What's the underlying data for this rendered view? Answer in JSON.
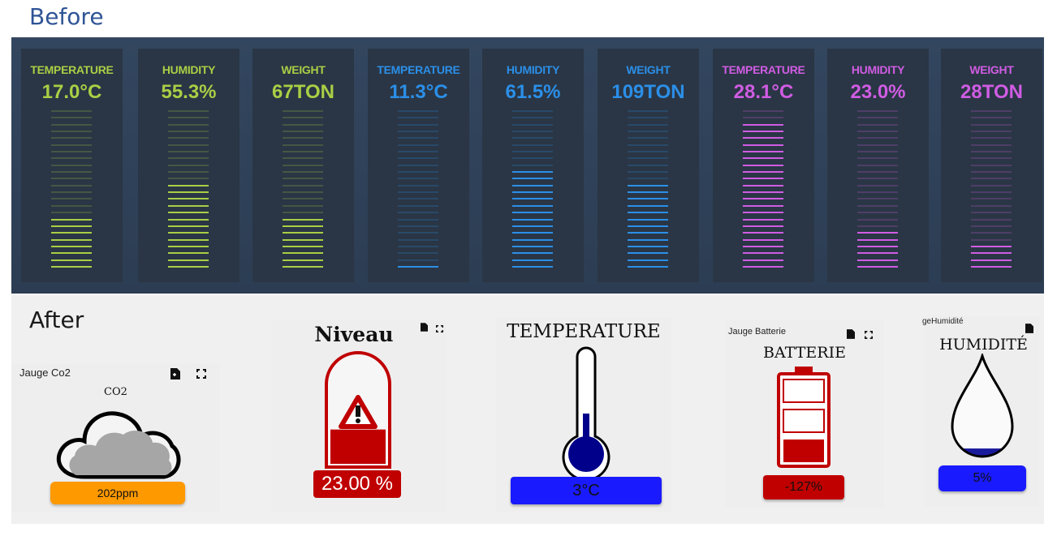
{
  "headings": {
    "before": "Before",
    "after": "After"
  },
  "before": {
    "gauges": [
      {
        "title": "TEMPERATURE",
        "value": "17.0°C",
        "level": 0.33,
        "color": "#a8cf45"
      },
      {
        "title": "HUMIDITY",
        "value": "55.3%",
        "level": 0.56,
        "color": "#a8cf45"
      },
      {
        "title": "WEIGHT",
        "value": "67TON",
        "level": 0.33,
        "color": "#a8cf45"
      },
      {
        "title": "TEMPERATURE",
        "value": "11.3°C",
        "level": 0.06,
        "color": "#2b8fe8"
      },
      {
        "title": "HUMIDITY",
        "value": "61.5%",
        "level": 0.62,
        "color": "#2b8fe8"
      },
      {
        "title": "WEIGHT",
        "value": "109TON",
        "level": 0.56,
        "color": "#2b8fe8"
      },
      {
        "title": "TEMPERATURE",
        "value": "28.1°C",
        "level": 0.93,
        "color": "#d05ce3"
      },
      {
        "title": "HUMIDITY",
        "value": "23.0%",
        "level": 0.23,
        "color": "#d05ce3"
      },
      {
        "title": "WEIGHT",
        "value": "28TON",
        "level": 0.15,
        "color": "#d05ce3"
      }
    ]
  },
  "after": {
    "co2": {
      "label": "Jauge Co2",
      "title": "CO2",
      "value": "202ppm",
      "color": "#ff9900",
      "icon": "cloud-icon"
    },
    "niveau": {
      "title": "Niveau",
      "value": "23.00 %",
      "level": 0.23,
      "color": "#c00000",
      "icon": "warning-icon"
    },
    "temperature": {
      "title": "TEMPERATURE",
      "value": "3°C",
      "color": "#1a1aff",
      "icon": "thermometer-icon"
    },
    "batterie": {
      "label": "Jauge Batterie",
      "title": "BATTERIE",
      "value": "-127%",
      "color": "#c00000",
      "icon": "battery-icon"
    },
    "humidite": {
      "label": "geHumidité",
      "title": "HUMIDITÉ",
      "value": "5%",
      "level": 0.05,
      "color": "#1a1aff",
      "icon": "water-drop-icon"
    }
  }
}
